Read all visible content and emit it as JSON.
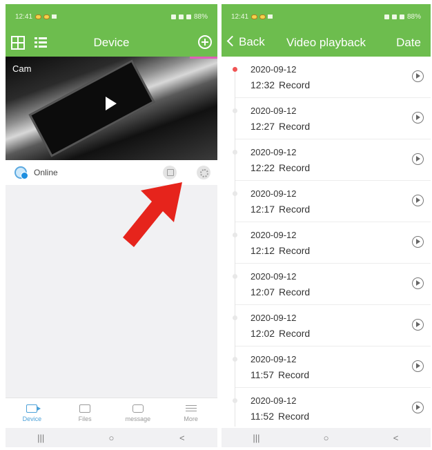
{
  "left": {
    "status": {
      "time": "12:41",
      "battery": "88%"
    },
    "header": {
      "title": "Device"
    },
    "camera": {
      "name": "Cam"
    },
    "device": {
      "status": "Online"
    },
    "tabs": [
      {
        "label": "Device",
        "icon": "video-camera-icon"
      },
      {
        "label": "Files",
        "icon": "image-icon"
      },
      {
        "label": "message",
        "icon": "message-icon"
      },
      {
        "label": "More",
        "icon": "menu-icon"
      }
    ],
    "sysnav": {
      "recent": "|||",
      "home": "○",
      "back": "<"
    }
  },
  "right": {
    "status": {
      "time": "12:41",
      "battery": "88%"
    },
    "header": {
      "back": "Back",
      "title": "Video playback",
      "date": "Date"
    },
    "records": [
      {
        "date": "2020-09-12",
        "time": "12:32",
        "type": "Record"
      },
      {
        "date": "2020-09-12",
        "time": "12:27",
        "type": "Record"
      },
      {
        "date": "2020-09-12",
        "time": "12:22",
        "type": "Record"
      },
      {
        "date": "2020-09-12",
        "time": "12:17",
        "type": "Record"
      },
      {
        "date": "2020-09-12",
        "time": "12:12",
        "type": "Record"
      },
      {
        "date": "2020-09-12",
        "time": "12:07",
        "type": "Record"
      },
      {
        "date": "2020-09-12",
        "time": "12:02",
        "type": "Record"
      },
      {
        "date": "2020-09-12",
        "time": "11:57",
        "type": "Record"
      },
      {
        "date": "2020-09-12",
        "time": "11:52",
        "type": "Record"
      }
    ],
    "sysnav": {
      "recent": "|||",
      "home": "○",
      "back": "<"
    }
  },
  "colors": {
    "header_green": "#6dbd4e",
    "accent_blue": "#4aa0d8",
    "arrow_red": "#e6241c",
    "active_dot": "#f05454"
  }
}
